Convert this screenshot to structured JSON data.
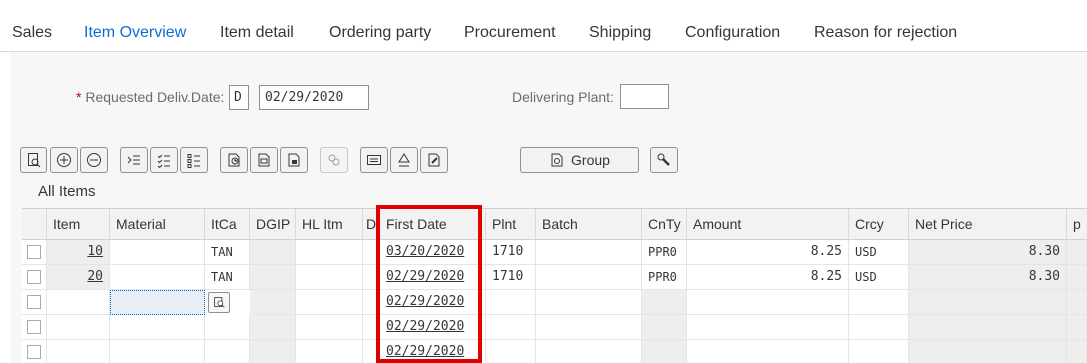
{
  "tabs": [
    "Sales",
    "Item Overview",
    "Item detail",
    "Ordering party",
    "Procurement",
    "Shipping",
    "Configuration",
    "Reason for rejection"
  ],
  "active_tab": "Item Overview",
  "header": {
    "required_marker": "*",
    "requested_deliv_label": "Requested Deliv.Date:",
    "date_type": "D",
    "requested_deliv_date": "02/29/2020",
    "delivering_plant_label": "Delivering Plant:",
    "delivering_plant_value": ""
  },
  "toolbar": {
    "icons": [
      "item-detail-icon",
      "expand-icon",
      "collapse-icon",
      "insert-row-icon",
      "select-all-icon",
      "deselect-all-icon",
      "schedule-lines-icon",
      "pricing-icon",
      "availability-icon",
      "configuration-icon",
      "display-icon",
      "structure-icon",
      "document-flow-icon"
    ],
    "group_label": "Group",
    "group_icon": "group-icon",
    "wrench_icon": "wrench-icon"
  },
  "section_title": "All Items",
  "columns": [
    "Item",
    "Material",
    "ItCa",
    "DGIP",
    "HL Itm",
    "D",
    "First Date",
    "Plnt",
    "Batch",
    "CnTy",
    "Amount",
    "Crcy",
    "Net Price",
    "p"
  ],
  "rows": [
    {
      "item": "10",
      "material": "",
      "itca": "TAN",
      "dgip": "",
      "hl_itm": "",
      "d": "",
      "first_date": "03/20/2020",
      "plnt": "1710",
      "batch": "",
      "cnty": "PPR0",
      "amount": "8.25",
      "crcy": "USD",
      "net_price": "8.30"
    },
    {
      "item": "20",
      "material": "",
      "itca": "TAN",
      "dgip": "",
      "hl_itm": "",
      "d": "",
      "first_date": "02/29/2020",
      "plnt": "1710",
      "batch": "",
      "cnty": "PPR0",
      "amount": "8.25",
      "crcy": "USD",
      "net_price": "8.30"
    },
    {
      "item": "",
      "material": "",
      "itca": "",
      "dgip": "",
      "hl_itm": "",
      "d": "",
      "first_date": "02/29/2020",
      "plnt": "",
      "batch": "",
      "cnty": "",
      "amount": "",
      "crcy": "",
      "net_price": ""
    },
    {
      "item": "",
      "material": "",
      "itca": "",
      "dgip": "",
      "hl_itm": "",
      "d": "",
      "first_date": "02/29/2020",
      "plnt": "",
      "batch": "",
      "cnty": "",
      "amount": "",
      "crcy": "",
      "net_price": ""
    },
    {
      "item": "",
      "material": "",
      "itca": "",
      "dgip": "",
      "hl_itm": "",
      "d": "",
      "first_date": "02/29/2020",
      "plnt": "",
      "batch": "",
      "cnty": "",
      "amount": "",
      "crcy": "",
      "net_price": ""
    }
  ],
  "colors": {
    "accent": "#0a6ed1",
    "highlight": "#e00000",
    "required": "#bb0000"
  }
}
